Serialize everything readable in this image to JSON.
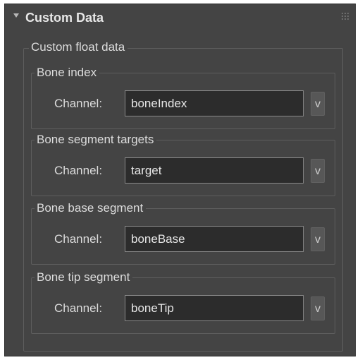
{
  "rollout": {
    "title": "Custom Data",
    "icons": {
      "collapse": "triangle-down-icon",
      "grip": "drag-grip-icon"
    }
  },
  "custom_float_data": {
    "label": "Custom float data",
    "groups": [
      {
        "title": "Bone index",
        "channel_label": "Channel:",
        "channel_value": "boneIndex",
        "button_label": "v"
      },
      {
        "title": "Bone segment targets",
        "channel_label": "Channel:",
        "channel_value": "target",
        "button_label": "v"
      },
      {
        "title": "Bone base segment",
        "channel_label": "Channel:",
        "channel_value": "boneBase",
        "button_label": "v"
      },
      {
        "title": "Bone tip segment",
        "channel_label": "Channel:",
        "channel_value": "boneTip",
        "button_label": "v"
      }
    ]
  },
  "colors": {
    "panel_bg": "#444444",
    "field_bg": "#2c2c2c",
    "text": "#dcdcdc",
    "group_border": "#5e5e5e"
  }
}
